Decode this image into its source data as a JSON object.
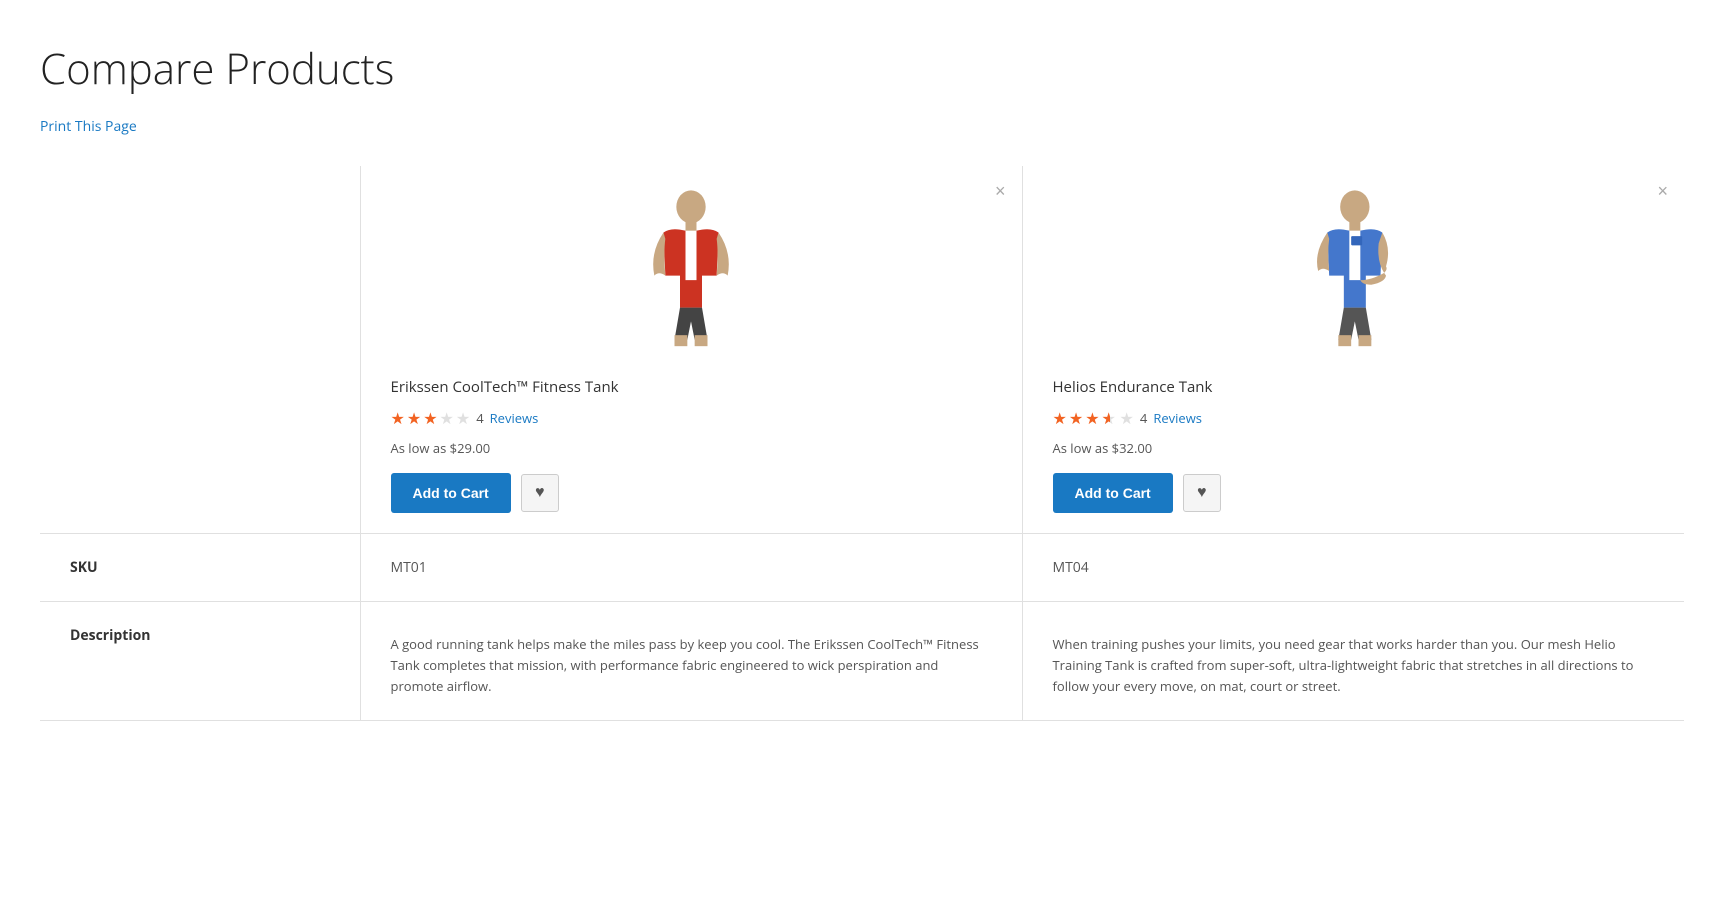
{
  "page": {
    "title": "Compare Products",
    "print_link": "Print This Page"
  },
  "products": [
    {
      "id": "product-1",
      "name": "Erikssen CoolTech™ Fitness Tank",
      "rating": 3,
      "rating_display": "3 out of 5",
      "reviews_count": "4",
      "reviews_label": "Reviews",
      "price": "As low as $29.00",
      "sku": "MT01",
      "description": "A good running tank helps make the miles pass by keep you cool. The Erikssen CoolTech™ Fitness Tank completes that mission, with performance fabric engineered to wick perspiration and promote airflow.",
      "shirt_color": "#d44",
      "add_to_cart_label": "Add to Cart"
    },
    {
      "id": "product-2",
      "name": "Helios Endurance Tank",
      "rating": 3.5,
      "rating_display": "3.5 out of 5",
      "reviews_count": "4",
      "reviews_label": "Reviews",
      "price": "As low as $32.00",
      "sku": "MT04",
      "description": "When training pushes your limits, you need gear that works harder than you. Our mesh Helio Training Tank is crafted from super-soft, ultra-lightweight fabric that stretches in all directions to follow your every move, on mat, court or street.",
      "shirt_color": "#4477cc",
      "add_to_cart_label": "Add to Cart"
    }
  ],
  "labels": {
    "sku": "SKU",
    "description": "Description",
    "remove_icon": "×",
    "wishlist_icon": "♥"
  }
}
